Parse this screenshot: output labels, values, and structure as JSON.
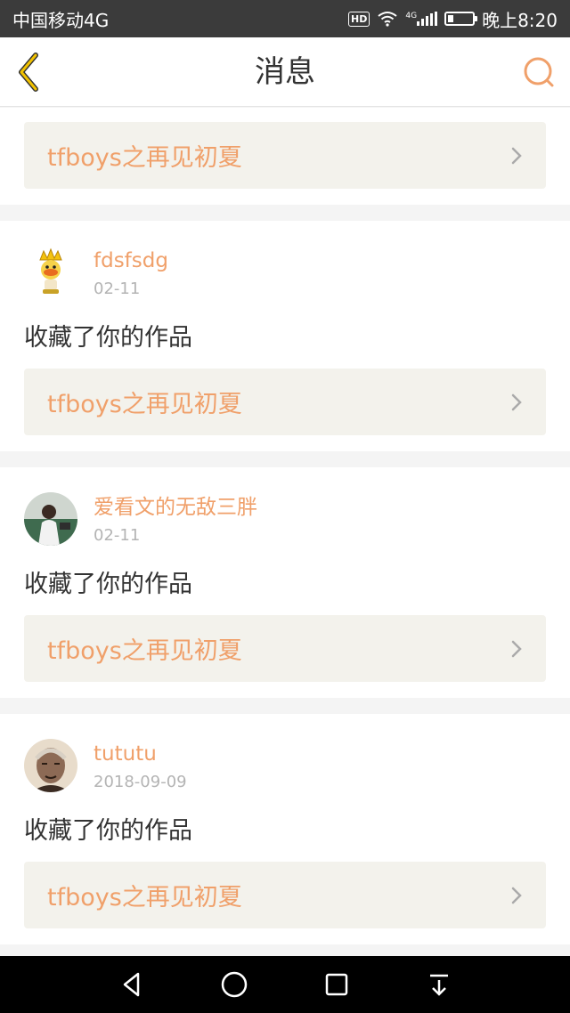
{
  "status_bar": {
    "carrier": "中国移动4G",
    "hd": "HD",
    "net": "4G",
    "time": "晚上8:20"
  },
  "header": {
    "title": "消息",
    "back_icon": "back-chevron-icon",
    "search_icon": "search-icon"
  },
  "colors": {
    "accent": "#f0a06a",
    "work_bg": "#f3f2ec",
    "text": "#333333",
    "muted": "#b4b4b4"
  },
  "messages": [
    {
      "work_title": "tfboys之再见初夏"
    },
    {
      "user": "fdsfsdg",
      "date": "02-11",
      "action": "收藏了你的作品",
      "work_title": "tfboys之再见初夏",
      "avatar": "crown-mascot"
    },
    {
      "user": "爱看文的无敌三胖",
      "date": "02-11",
      "action": "收藏了你的作品",
      "work_title": "tfboys之再见初夏",
      "avatar": "photo-green"
    },
    {
      "user": "tututu",
      "date": "2018-09-09",
      "action": "收藏了你的作品",
      "work_title": "tfboys之再见初夏",
      "avatar": "photo-elder"
    }
  ],
  "nav_bar": {
    "icons": [
      "back-triangle-icon",
      "home-circle-icon",
      "recents-square-icon",
      "dropdown-icon"
    ]
  }
}
